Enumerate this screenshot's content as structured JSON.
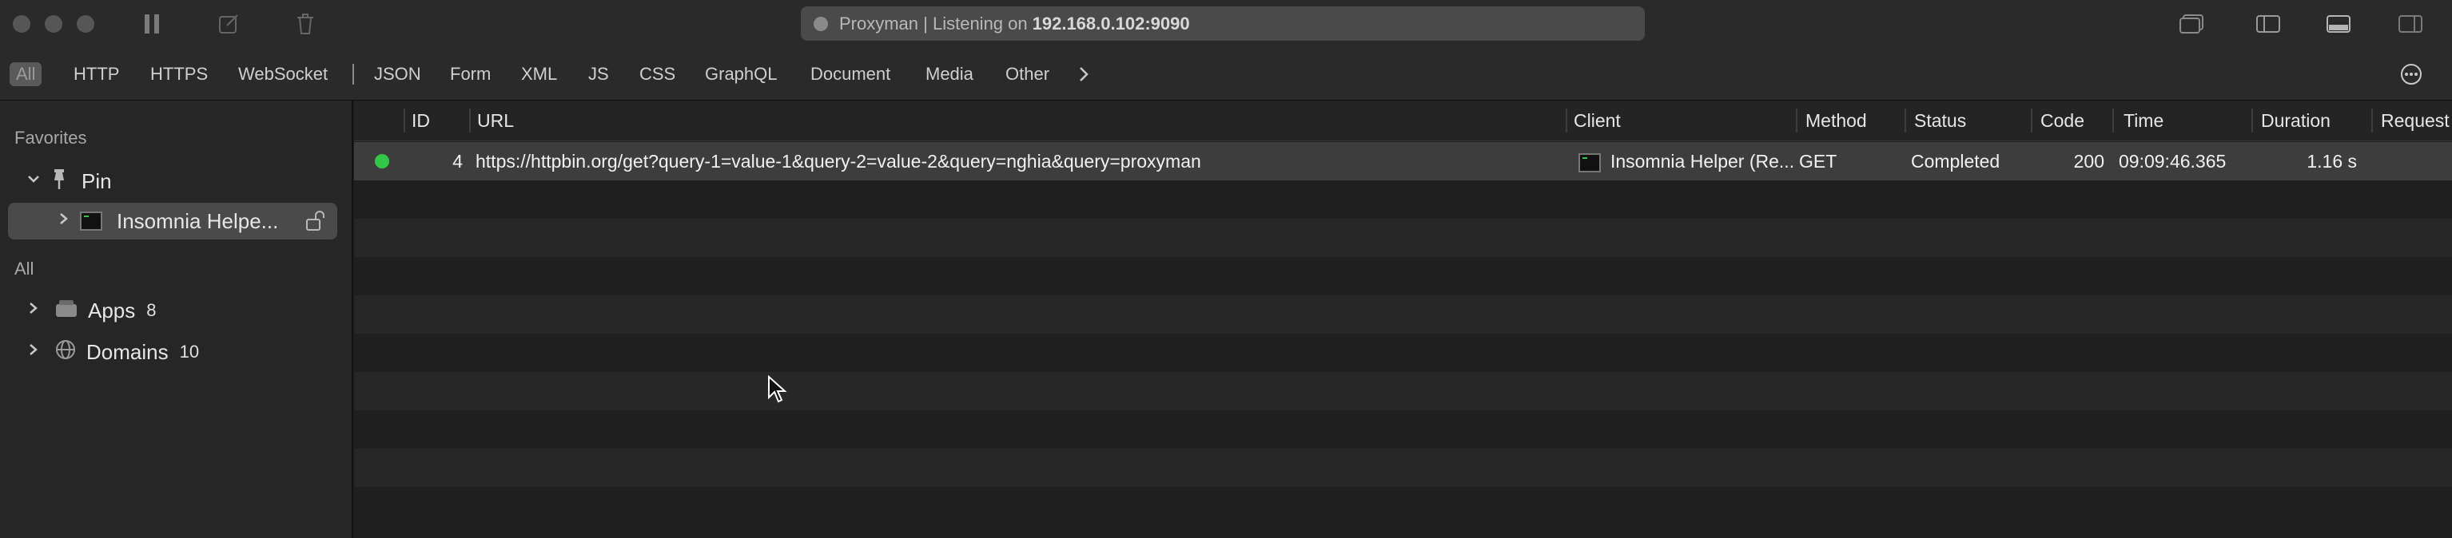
{
  "titlebar": {
    "address_prefix": "Proxyman | Listening on",
    "address_host": "192.168.0.102:9090",
    "icons": [
      "pause-icon",
      "compose-icon",
      "trash-icon",
      "window-icon",
      "sidebar-left-icon",
      "panel-bottom-icon",
      "sidebar-right-icon"
    ]
  },
  "filters": {
    "items": [
      "All",
      "HTTP",
      "HTTPS",
      "WebSocket",
      "JSON",
      "Form",
      "XML",
      "JS",
      "CSS",
      "GraphQL",
      "Document",
      "Media",
      "Other"
    ],
    "active": "All",
    "more_icon": "chevron-right-icon",
    "options_icon": "ellipsis-circle-icon"
  },
  "sidebar": {
    "favorites_label": "Favorites",
    "pin_label": "Pin",
    "pinned_item": "Insomnia Helpe...",
    "all_label": "All",
    "apps_label": "Apps",
    "apps_count": "8",
    "domains_label": "Domains",
    "domains_count": "10"
  },
  "table": {
    "columns": [
      "ID",
      "URL",
      "Client",
      "Method",
      "Status",
      "Code",
      "Time",
      "Duration",
      "Request"
    ],
    "rows": [
      {
        "id": "4",
        "url": "https://httpbin.org/get?query-1=value-1&query-2=value-2&query=nghia&query=proxyman",
        "client": "Insomnia Helper (Re...",
        "method": "GET",
        "status": "Completed",
        "code": "200",
        "time": "09:09:46.365",
        "duration": "1.16 s",
        "request": ""
      }
    ]
  },
  "colors": {
    "status_ok": "#33c748",
    "background": "#1e1e1e",
    "selected_row": "#3d3d3d"
  }
}
